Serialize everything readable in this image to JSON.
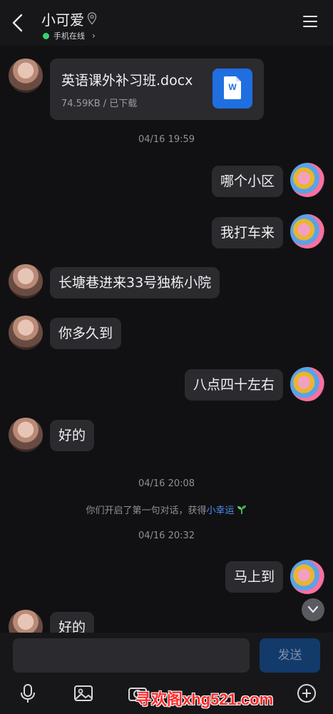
{
  "header": {
    "title": "小可爱",
    "status": "手机在线",
    "back_icon": "back-arrow-icon",
    "location_icon": "location-pin-icon",
    "menu_icon": "hamburger-menu-icon"
  },
  "file_message": {
    "file_name": "英语课外补习班.docx",
    "meta": "74.59KB / 已下载",
    "icon": "word-doc-icon",
    "icon_letter": "W"
  },
  "timestamps": {
    "t1": "04/16 19:59",
    "t2": "04/16 20:08",
    "t3": "04/16 20:32"
  },
  "messages": [
    {
      "side": "right",
      "text": "哪个小区"
    },
    {
      "side": "right",
      "text": "我打车来"
    },
    {
      "side": "left",
      "text": "长塘巷进来33号独栋小院"
    },
    {
      "side": "left",
      "text": "你多久到"
    },
    {
      "side": "right",
      "text": "八点四十左右"
    },
    {
      "side": "left",
      "text": "好的"
    },
    {
      "side": "right",
      "text": "马上到"
    },
    {
      "side": "left",
      "text": "好的"
    }
  ],
  "system_notice": {
    "text": "你们开启了第一句对话，获得",
    "link": "小幸运"
  },
  "input": {
    "placeholder": "",
    "send_label": "发送"
  },
  "toolbar_icons": [
    "microphone-icon",
    "image-icon",
    "camera-icon",
    "add-icon"
  ],
  "watermark": "寻欢阁xhg521.com",
  "colors": {
    "background": "#111113",
    "bubble": "#2b2b2f",
    "send_button": "#123a6b",
    "link": "#4f8ff0",
    "online": "#35d56a",
    "word_blue": "#1f6fe0"
  }
}
